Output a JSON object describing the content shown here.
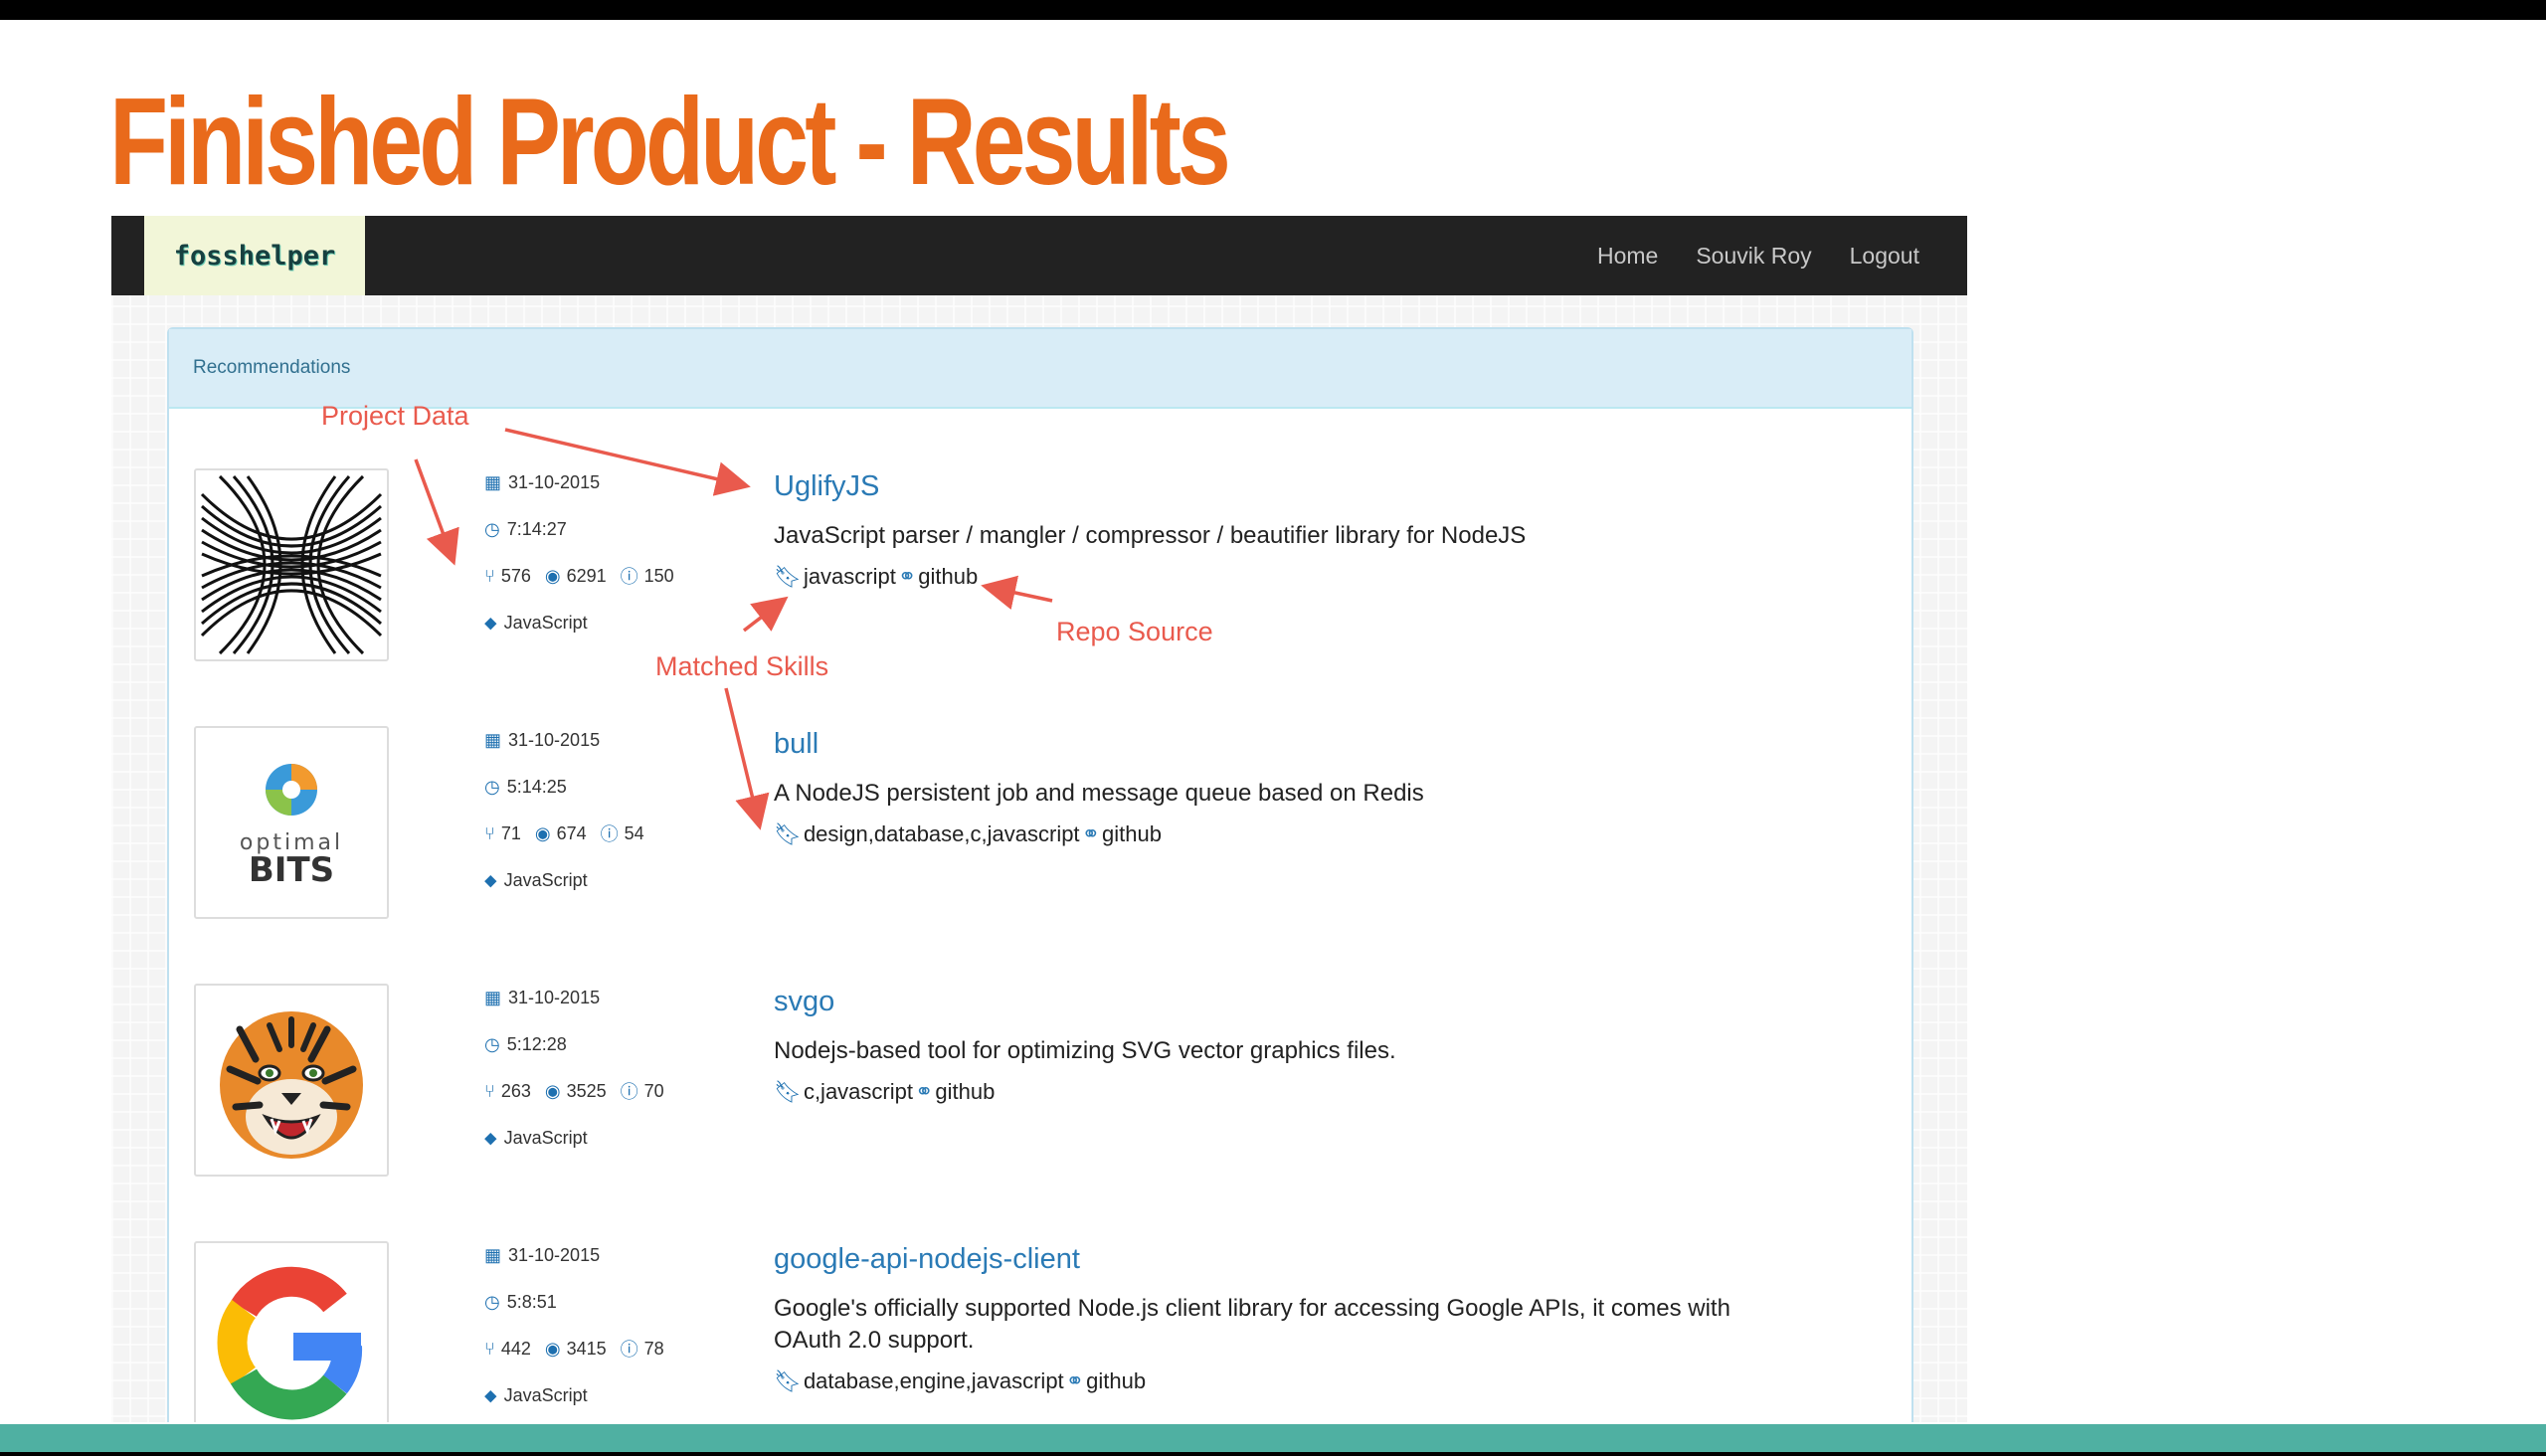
{
  "slide": {
    "title": "Finished Product - Results",
    "title_color": "#e96a1b",
    "stripe_color": "#4fb0a2"
  },
  "app": {
    "brand": "fosshelper",
    "nav": [
      "Home",
      "Souvik Roy",
      "Logout"
    ],
    "panel_title": "Recommendations"
  },
  "projects": [
    {
      "name": "UglifyJS",
      "description": "JavaScript parser / mangler / compressor / beautifier library for NodeJS",
      "skills": "javascript",
      "source": "github",
      "date": "31-10-2015",
      "time": "7:14:27",
      "forks": "576",
      "watchers": "6291",
      "issues": "150",
      "language": "JavaScript",
      "logo": "moire-pattern-icon"
    },
    {
      "name": "bull",
      "description": "A NodeJS persistent job and message queue based on Redis",
      "skills": "design,database,c,javascript",
      "source": "github",
      "date": "31-10-2015",
      "time": "5:14:25",
      "forks": "71",
      "watchers": "674",
      "issues": "54",
      "language": "JavaScript",
      "logo": "optimalbits-logo",
      "logo_text_top": "optimal",
      "logo_text_bottom": "BITS"
    },
    {
      "name": "svgo",
      "description": "Nodejs-based tool for optimizing SVG vector graphics files.",
      "skills": "c,javascript",
      "source": "github",
      "date": "31-10-2015",
      "time": "5:12:28",
      "forks": "263",
      "watchers": "3525",
      "issues": "70",
      "language": "JavaScript",
      "logo": "tiger-icon"
    },
    {
      "name": "google-api-nodejs-client",
      "description": "Google's officially supported Node.js client library for accessing Google APIs, it comes with OAuth 2.0 support.",
      "skills": "database,engine,javascript",
      "source": "github",
      "date": "31-10-2015",
      "time": "5:8:51",
      "forks": "442",
      "watchers": "3415",
      "issues": "78",
      "language": "JavaScript",
      "logo": "google-g-icon"
    }
  ],
  "annotations": {
    "project_data": "Project Data",
    "repo_source": "Repo Source",
    "matched_skills": "Matched Skills",
    "color": "#e95a4d"
  }
}
